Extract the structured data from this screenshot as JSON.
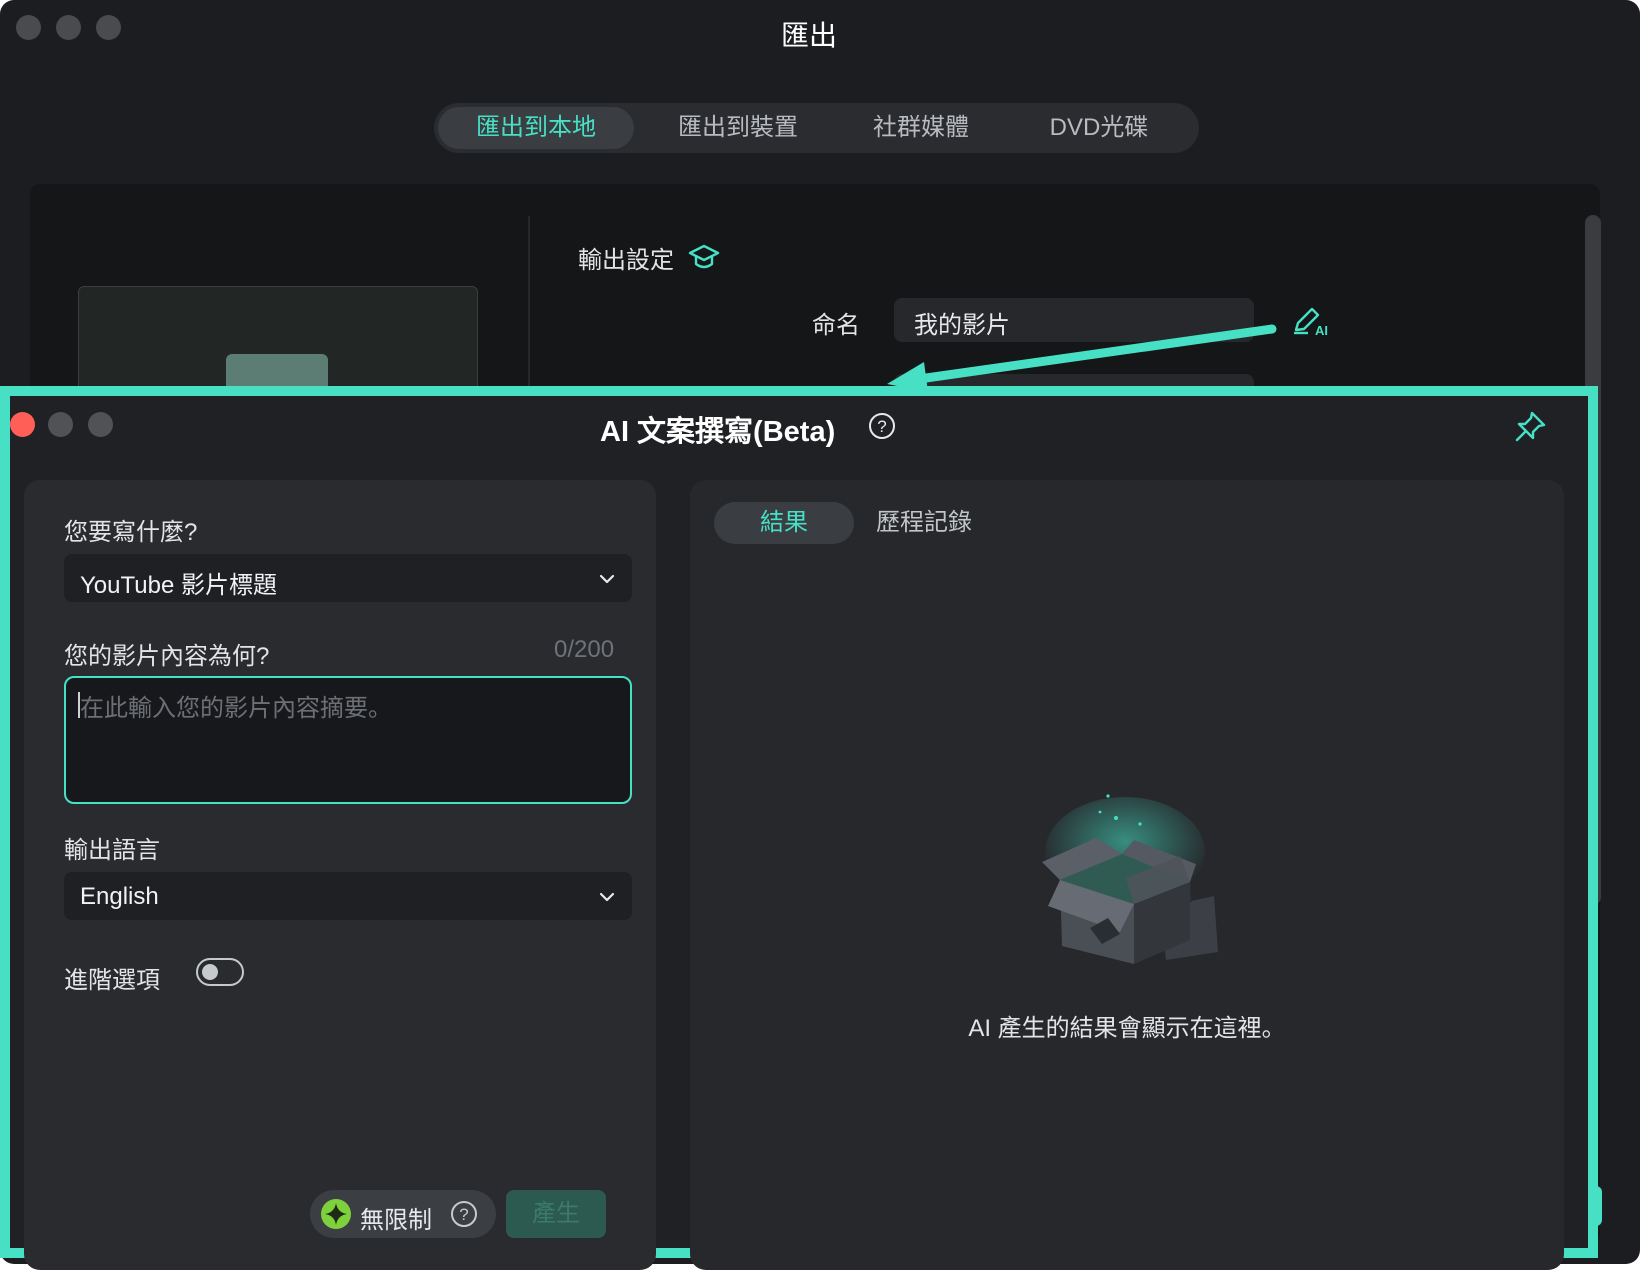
{
  "export_window": {
    "title": "匯出",
    "tabs": [
      {
        "label": "匯出到本地",
        "active": true
      },
      {
        "label": "匯出到裝置",
        "active": false
      },
      {
        "label": "社群媒體",
        "active": false
      },
      {
        "label": "DVD光碟",
        "active": false
      }
    ],
    "output_settings_label": "輸出設定",
    "name_label": "命名",
    "name_value": "我的影片"
  },
  "ai_dialog": {
    "title": "AI 文案撰寫(Beta)",
    "what_to_write_label": "您要寫什麼?",
    "what_to_write_value": "YouTube 影片標題",
    "content_label": "您的影片內容為何?",
    "content_counter": "0/200",
    "content_placeholder": "在此輸入您的影片內容摘要。",
    "language_label": "輸出語言",
    "language_value": "English",
    "advanced_label": "進階選項",
    "advanced_enabled": false,
    "unlimited_label": "無限制",
    "generate_label": "產生",
    "result_tabs": [
      {
        "label": "結果",
        "active": true
      },
      {
        "label": "歷程記錄",
        "active": false
      }
    ],
    "empty_state_text": "AI 產生的結果會顯示在這裡。"
  },
  "colors": {
    "accent": "#47e0c5",
    "window_bg": "#1c1d20",
    "panel_bg": "#292b2f",
    "close_red": "#ff5f57"
  },
  "icons": [
    "graduation-cap-icon",
    "ai-pencil-icon",
    "help-icon",
    "pin-icon",
    "chevron-down-icon",
    "sparkle-icon",
    "open-box-icon"
  ]
}
